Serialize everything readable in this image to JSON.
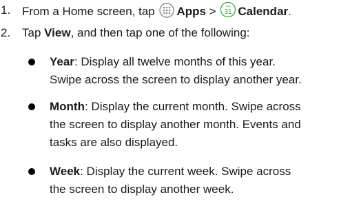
{
  "steps": [
    {
      "number": "1.",
      "prefix": "From a Home screen, tap",
      "apps_label": "Apps",
      "separator": ">",
      "calendar_label": "Calendar",
      "calendar_icon_text": {
        "day_label": "THU",
        "date": "31"
      },
      "period": "."
    },
    {
      "number": "2.",
      "prefix": "Tap ",
      "view_label": "View",
      "suffix": ", and then tap one of the following:"
    }
  ],
  "bullets": [
    {
      "term": "Year",
      "lines": [
        ": Display all twelve months of this year.",
        "Swipe across the screen to display another year."
      ]
    },
    {
      "term": "Month",
      "lines": [
        ": Display the current month. Swipe across",
        "the screen to display another month. Events and",
        "tasks are also displayed."
      ]
    },
    {
      "term": "Week",
      "lines": [
        ": Display the current week. Swipe across",
        "the screen to display another week."
      ]
    }
  ],
  "colors": {
    "text": "#1a1a1a",
    "calendar_accent": "#3c9e3a",
    "apps_icon": "#8a8a8a"
  }
}
